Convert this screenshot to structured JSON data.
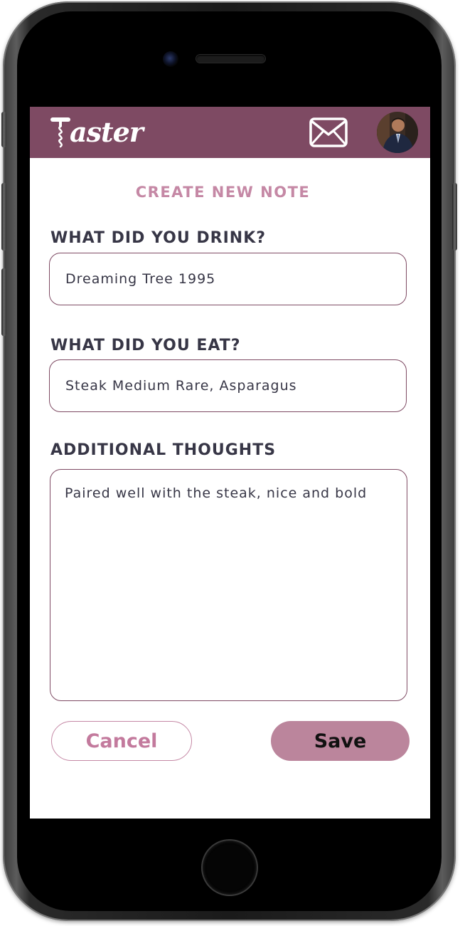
{
  "app": {
    "name": "Taster",
    "brand_color": "#7e4a63",
    "accent_color": "#c588a5"
  },
  "header": {
    "logo_text": "aster",
    "mail_icon": "envelope-icon",
    "avatar": "user-avatar"
  },
  "page": {
    "title": "CREATE NEW NOTE"
  },
  "form": {
    "drink": {
      "label": "WHAT DID YOU DRINK?",
      "value": "Dreaming Tree 1995"
    },
    "eat": {
      "label": "WHAT DID YOU EAT?",
      "value": "Steak Medium Rare, Asparagus"
    },
    "thoughts": {
      "label": "ADDITIONAL THOUGHTS",
      "value": "Paired well with the steak, nice and bold"
    }
  },
  "actions": {
    "cancel_label": "Cancel",
    "save_label": "Save"
  }
}
